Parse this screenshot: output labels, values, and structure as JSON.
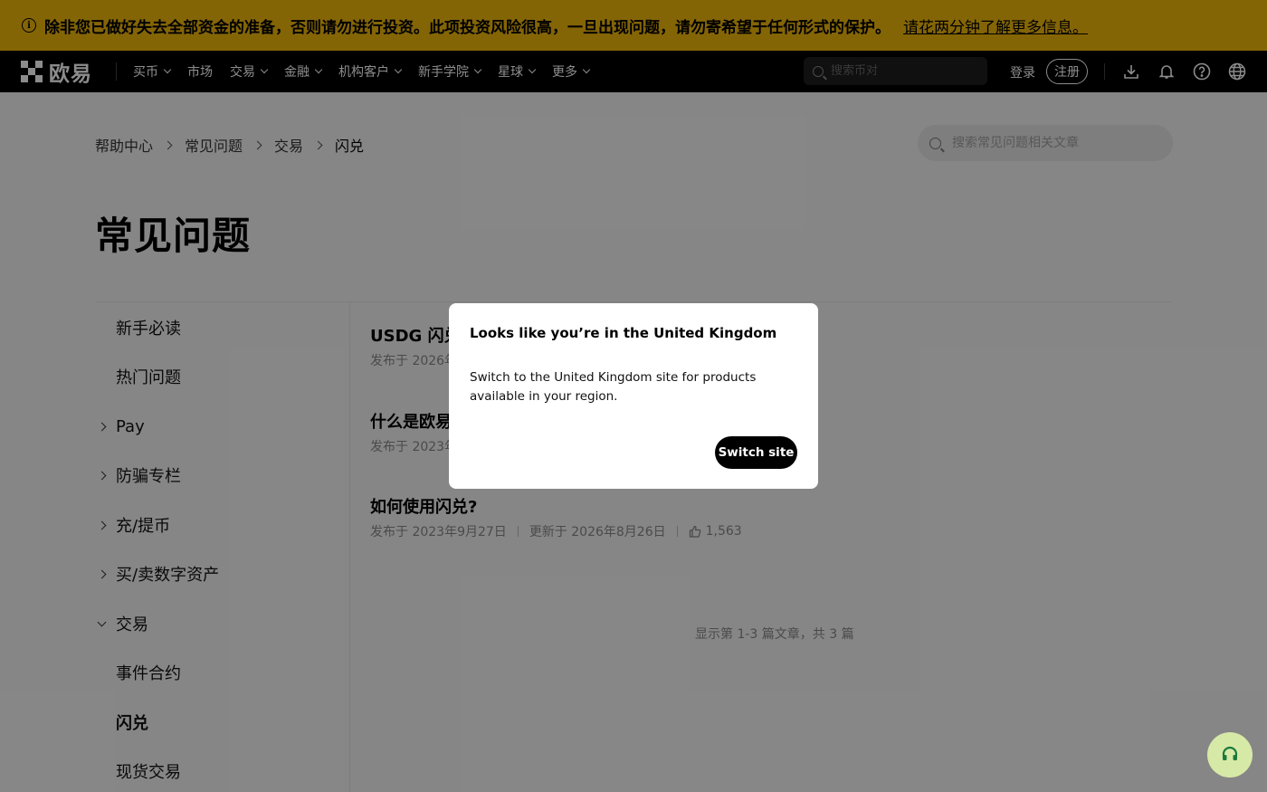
{
  "banner": {
    "text": "除非您已做好失去全部资金的准备，否则请勿进行投资。此项投资风险很高，一旦出现问题，请勿寄希望于任何形式的保护。",
    "link": "请花两分钟了解更多信息。"
  },
  "nav": {
    "logo_text": "欧易",
    "items": [
      {
        "label": "买币",
        "dropdown": true
      },
      {
        "label": "市场",
        "dropdown": false
      },
      {
        "label": "交易",
        "dropdown": true
      },
      {
        "label": "金融",
        "dropdown": true
      },
      {
        "label": "机构客户",
        "dropdown": true
      },
      {
        "label": "新手学院",
        "dropdown": true
      },
      {
        "label": "星球",
        "dropdown": true
      },
      {
        "label": "更多",
        "dropdown": true
      }
    ],
    "search_placeholder": "搜索币对",
    "login": "登录",
    "register": "注册",
    "icons": [
      "download-icon",
      "bell-icon",
      "help-icon",
      "globe-icon"
    ]
  },
  "breadcrumb": [
    "帮助中心",
    "常见问题",
    "交易",
    "闪兑"
  ],
  "help_search_placeholder": "搜索常见问题相关文章",
  "page_title": "常见问题",
  "sidebar": {
    "items": [
      {
        "label": "新手必读",
        "arrow": "none",
        "active": false
      },
      {
        "label": "热门问题",
        "arrow": "none",
        "active": false
      },
      {
        "label": "Pay",
        "arrow": "right",
        "active": false
      },
      {
        "label": "防骗专栏",
        "arrow": "right",
        "active": false
      },
      {
        "label": "充/提币",
        "arrow": "right",
        "active": false
      },
      {
        "label": "买/卖数字资产",
        "arrow": "right",
        "active": false
      },
      {
        "label": "交易",
        "arrow": "down",
        "active": false
      },
      {
        "label": "事件合约",
        "arrow": "none",
        "active": false
      },
      {
        "label": "闪兑",
        "arrow": "none",
        "active": true
      },
      {
        "label": "现货交易",
        "arrow": "none",
        "active": false
      }
    ]
  },
  "articles": [
    {
      "title": "USDG 闪兑",
      "meta": "发布于 2026年"
    },
    {
      "title": "什么是欧易",
      "meta": "发布于 2023年"
    },
    {
      "title": "如何使用闪兑?",
      "published": "发布于 2023年9月27日",
      "updated": "更新于 2026年8月26日",
      "likes": "1,563"
    }
  ],
  "pagination": "显示第 1-3 篇文章，共 3 篇",
  "modal": {
    "title": "Looks like you’re in the United Kingdom",
    "body": "Switch to the United Kingdom site for products available in your region.",
    "button": "Switch site"
  },
  "colors": {
    "banner": "#f0b90b",
    "nav": "#000000",
    "support_button": "#d7e9a7"
  }
}
